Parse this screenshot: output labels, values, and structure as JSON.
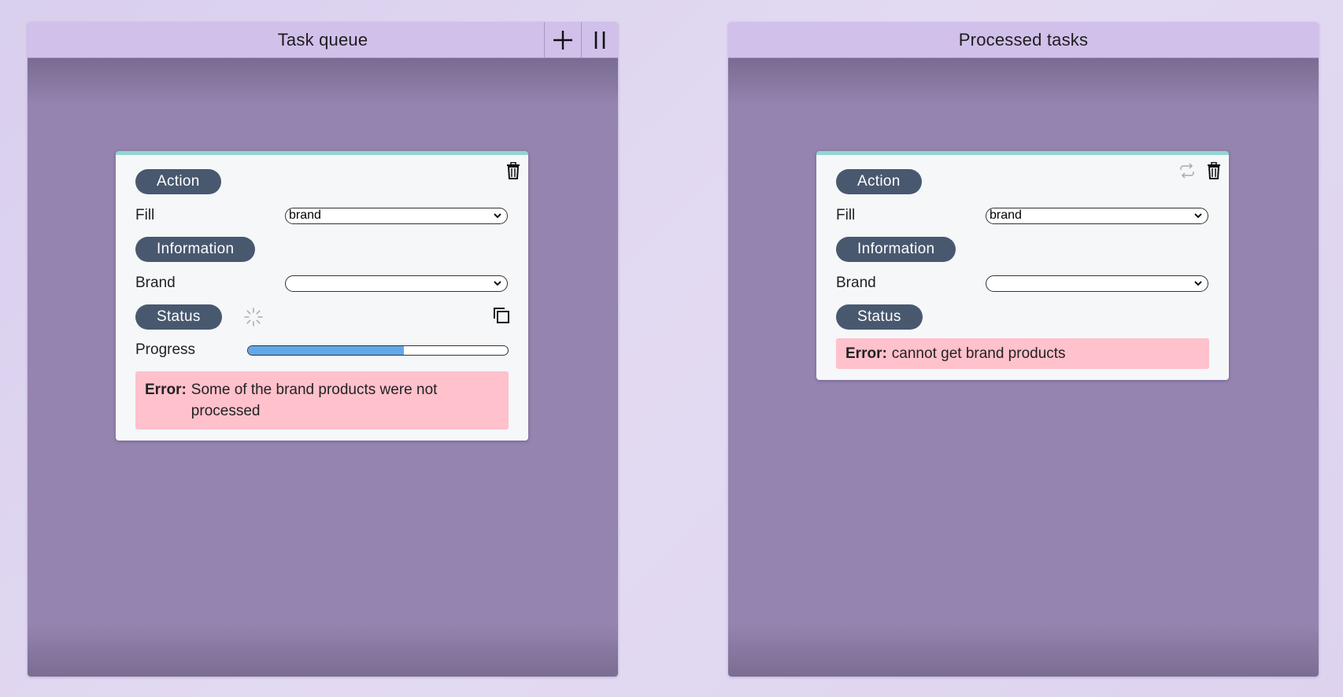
{
  "queue": {
    "title": "Task queue",
    "add_icon": "plus-icon",
    "pause_icon": "pause-icon",
    "card": {
      "action_label": "Action",
      "fill_label": "Fill",
      "fill_value": "brand",
      "info_label": "Information",
      "brand_label": "Brand",
      "brand_value": "",
      "status_label": "Status",
      "progress_label": "Progress",
      "progress_fraction": 0.6,
      "error_prefix": "Error:",
      "error_text": "Some of the brand products were not processed"
    }
  },
  "processed": {
    "title": "Processed tasks",
    "card": {
      "action_label": "Action",
      "fill_label": "Fill",
      "fill_value": "brand",
      "info_label": "Information",
      "brand_label": "Brand",
      "brand_value": "",
      "status_label": "Status",
      "error_prefix": "Error:",
      "error_text": "cannot get brand products"
    }
  },
  "colors": {
    "header_bg": "#d1c0ea",
    "body_bg": "#9484af",
    "pill_bg": "#48586f",
    "card_accent": "#8fd7d0",
    "error_bg": "#ffc1cc",
    "progress_fill": "#63a7e8"
  }
}
